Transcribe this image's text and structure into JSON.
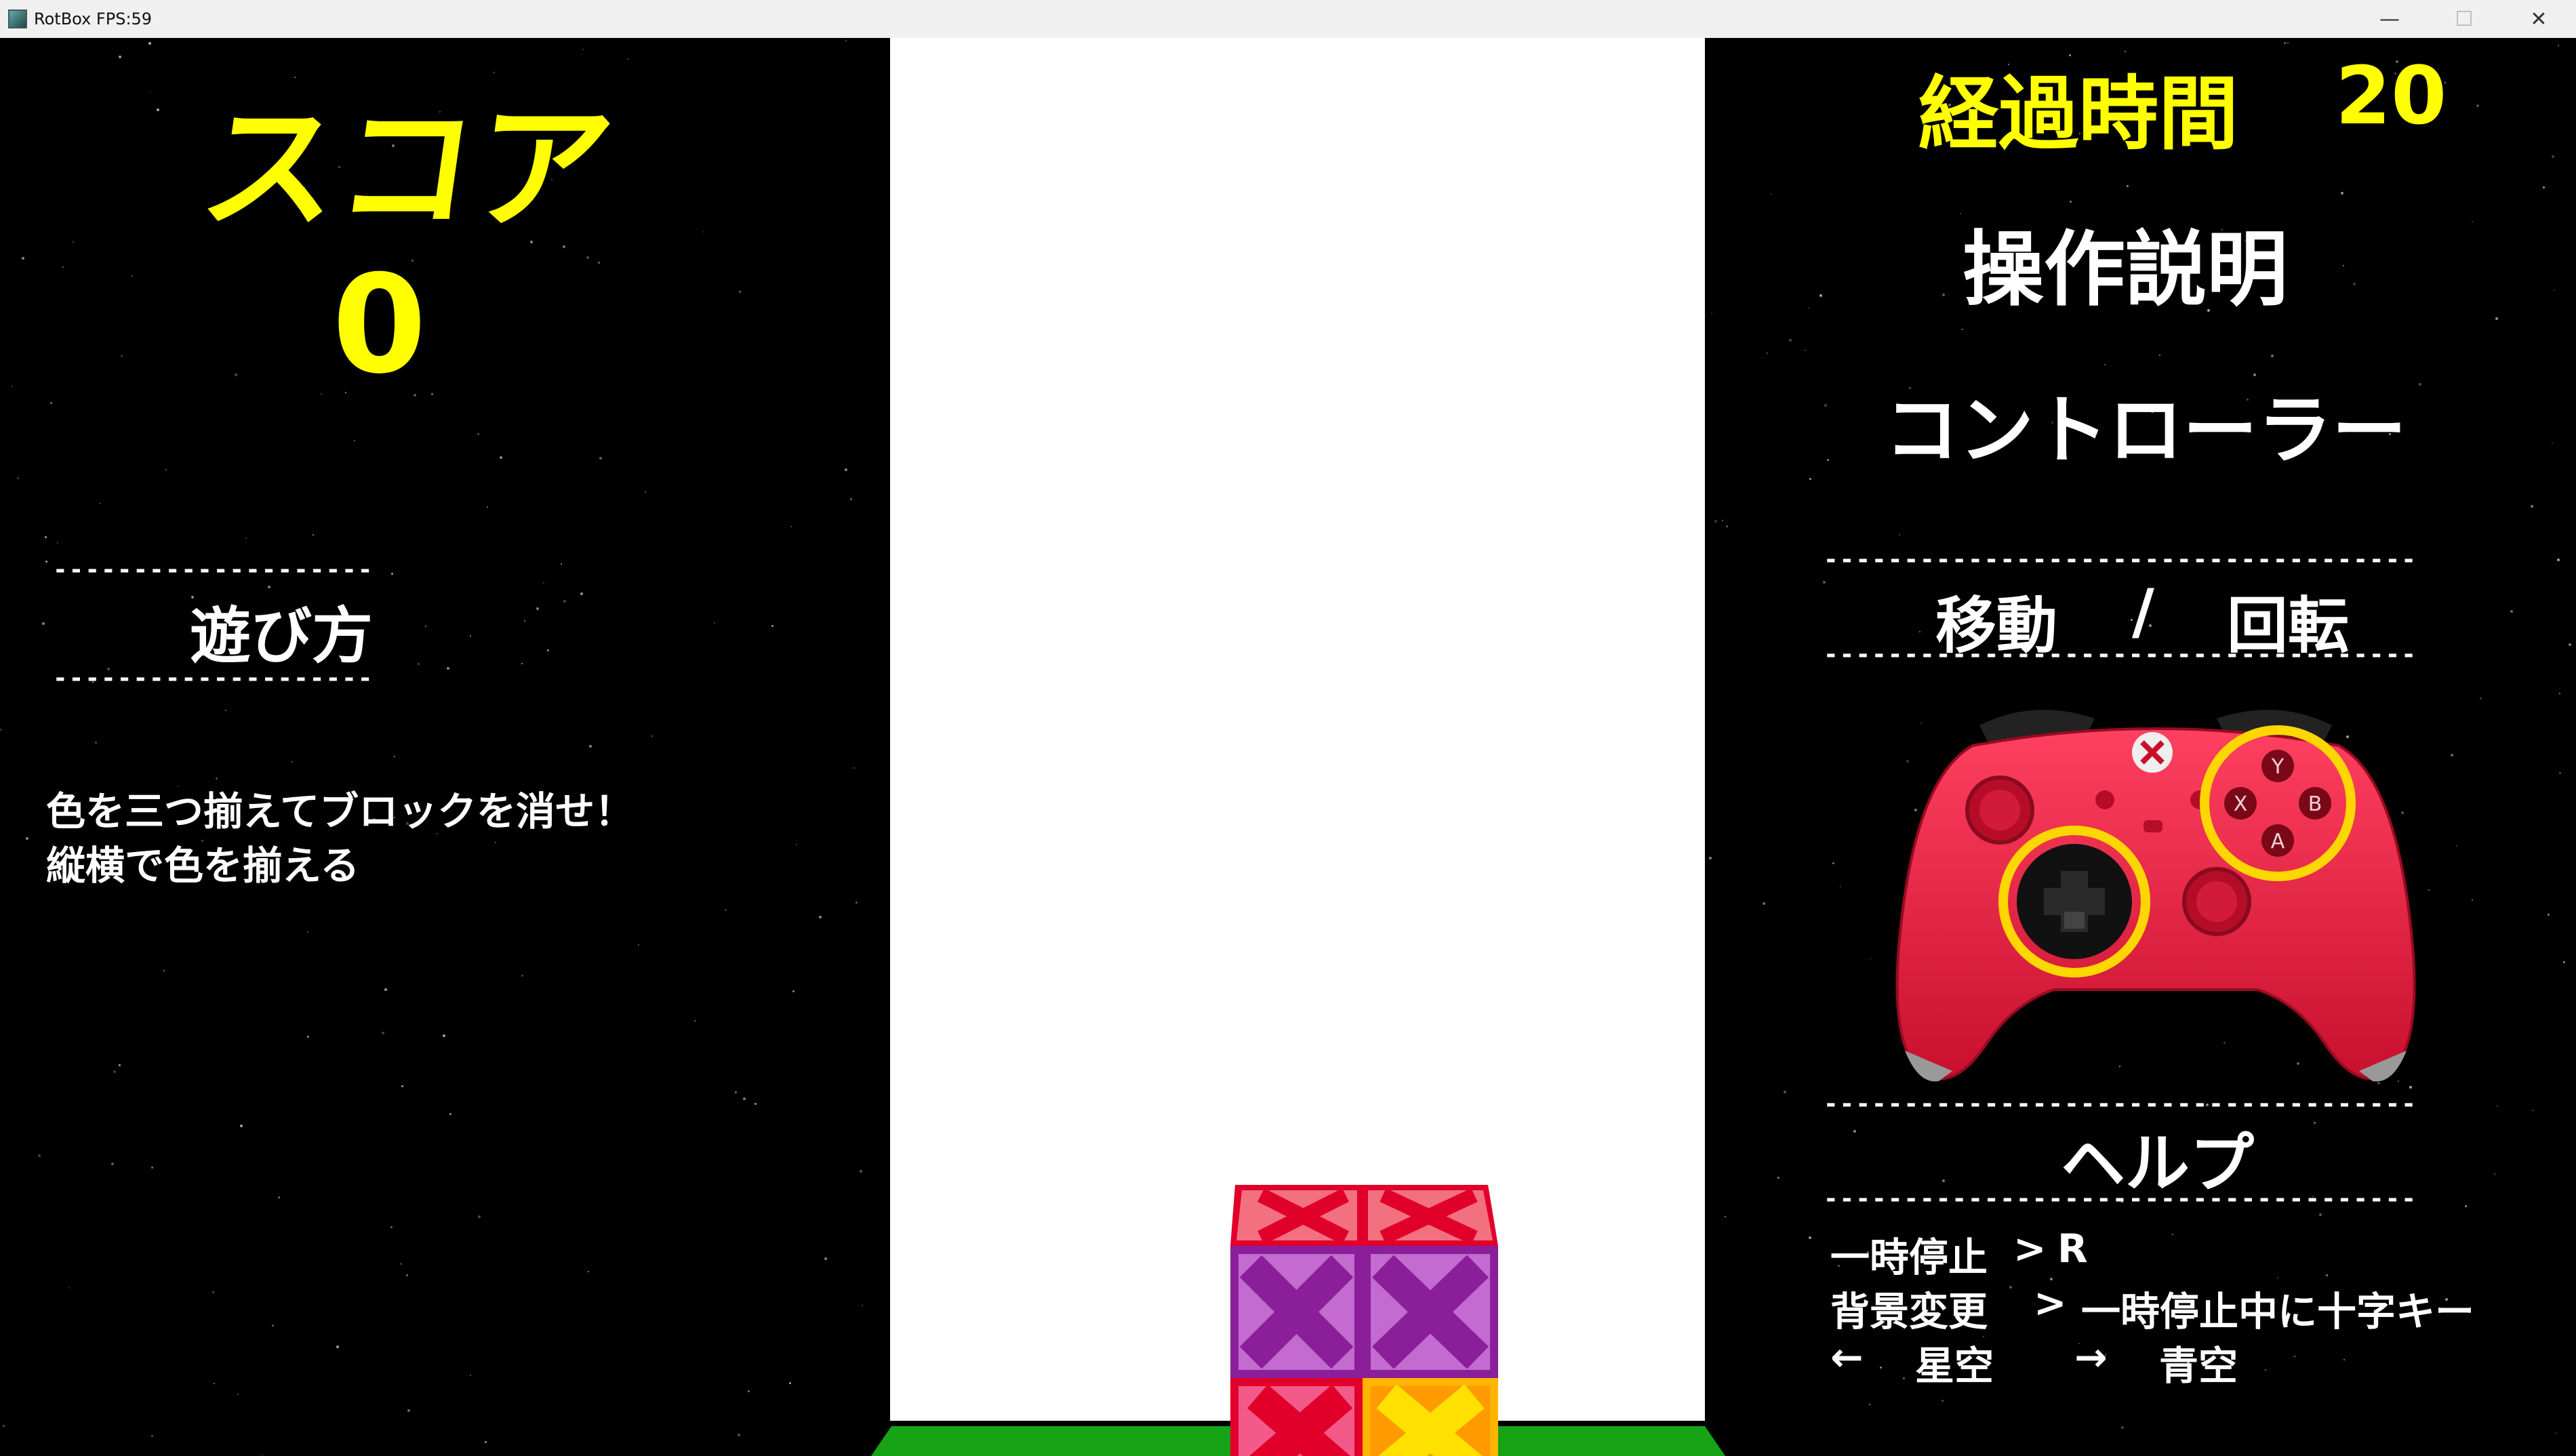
{
  "window": {
    "title": "RotBox FPS:59",
    "minimize": "—",
    "maximize": "☐",
    "close": "✕"
  },
  "score": {
    "label": "スコア",
    "value": "0"
  },
  "how_to_play": {
    "divider": "--------------------",
    "title": "遊び方",
    "lines": [
      "色を三つ揃えてブロックを消せ！",
      "縦横で色を揃える"
    ]
  },
  "elapsed": {
    "label": "経過時間",
    "value": "20"
  },
  "controls": {
    "title": "操作説明",
    "device": "コントローラー",
    "divider": "-------------------------------------",
    "move": "移動",
    "slash": "/",
    "rotate": "回転"
  },
  "help": {
    "title": "ヘルプ",
    "pause_key": "一時停止",
    "pause_arrow": ">",
    "pause_value": "R",
    "bg_key": "背景変更",
    "bg_arrow": ">",
    "bg_value": "一時停止中に十字キー",
    "left_arrow": "←",
    "left_value": "星空",
    "right_arrow": "→",
    "right_value": "青空"
  },
  "controller_buttons": {
    "y": "Y",
    "x": "X",
    "b": "B",
    "a": "A"
  },
  "colors": {
    "accent_yellow": "#ffff00",
    "controller_red": "#e8254a",
    "highlight_ring": "#ffd700",
    "ground_green": "#16a316",
    "block_red": "#e0002a",
    "block_purple": "#9b2fa8",
    "block_pink": "#f06090",
    "block_yellow": "#ffd400"
  }
}
